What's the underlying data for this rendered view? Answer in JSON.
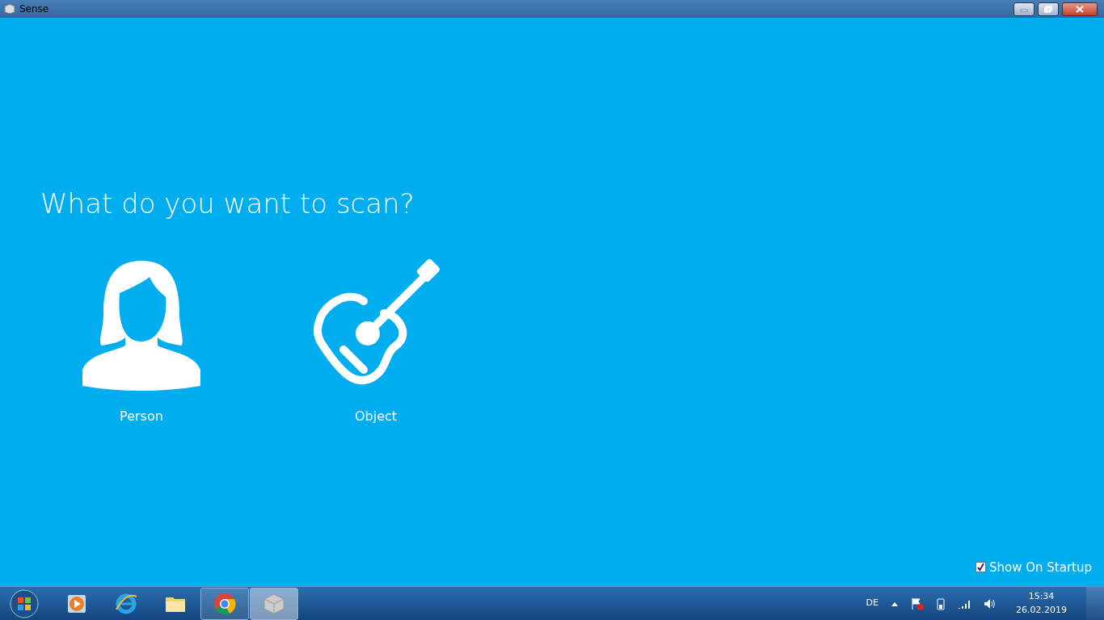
{
  "window": {
    "title": "Sense"
  },
  "heading": "What do you want to scan?",
  "choices": [
    {
      "kind": "person",
      "label": "Person"
    },
    {
      "kind": "object",
      "label": "Object"
    }
  ],
  "show_on_startup": {
    "label": "Show On Startup",
    "checked": true
  },
  "taskbar": {
    "apps": [
      {
        "kind": "media",
        "running": false,
        "selected": false
      },
      {
        "kind": "browser-e",
        "running": false,
        "selected": false
      },
      {
        "kind": "folder",
        "running": false,
        "selected": false
      },
      {
        "kind": "chrome",
        "running": true,
        "selected": false
      },
      {
        "kind": "cube",
        "running": true,
        "selected": true
      }
    ],
    "language": "DE",
    "time": "15:34",
    "date": "26.02.2019"
  }
}
